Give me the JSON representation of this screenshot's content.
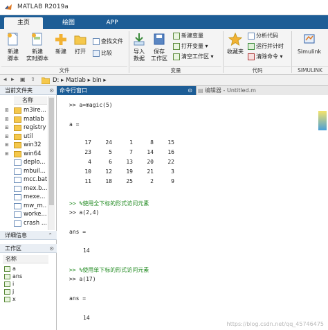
{
  "window": {
    "title": "MATLAB R2019a"
  },
  "tabs": [
    {
      "label": "主页",
      "active": true
    },
    {
      "label": "绘图",
      "active": false
    },
    {
      "label": "APP",
      "active": false
    }
  ],
  "ribbon": {
    "new_script": "新建\n脚本",
    "new_live_script": "新建\n实时脚本",
    "new": "新建",
    "open": "打开",
    "find_files": "查找文件",
    "compare": "比较",
    "import_data": "导入\n数据",
    "save_workspace": "保存\n工作区",
    "new_variable": "新建变量",
    "open_variable": "打开变量",
    "clear_workspace": "清空工作区",
    "favorites": "收藏夹",
    "analyze_code": "分析代码",
    "run_and_time": "运行并计时",
    "clear_commands": "清除命令",
    "simulink": "Simulink",
    "groups": {
      "file": "文件",
      "variable": "变量",
      "code": "代码",
      "simulink": "SIMULINK"
    }
  },
  "address": {
    "path": "D:  ▸  Matlab  ▸  bin  ▸"
  },
  "current_folder": {
    "title": "当前文件夹",
    "column": "名称",
    "items": [
      {
        "name": "m3ire...",
        "type": "folder"
      },
      {
        "name": "matlab",
        "type": "folder"
      },
      {
        "name": "registry",
        "type": "folder"
      },
      {
        "name": "util",
        "type": "folder"
      },
      {
        "name": "win32",
        "type": "folder"
      },
      {
        "name": "win64",
        "type": "folder"
      },
      {
        "name": "deplo...",
        "type": "file"
      },
      {
        "name": "mbuil...",
        "type": "file"
      },
      {
        "name": "mcc.bat",
        "type": "file"
      },
      {
        "name": "mex.b...",
        "type": "file"
      },
      {
        "name": "mexe...",
        "type": "file"
      },
      {
        "name": "mw_m...",
        "type": "file"
      },
      {
        "name": "worke...",
        "type": "file"
      },
      {
        "name": "crash ...",
        "type": "file"
      }
    ]
  },
  "details": {
    "title": "详细信息"
  },
  "workspace": {
    "title": "工作区",
    "column": "名称",
    "variables": [
      "a",
      "ans",
      "i",
      "j",
      "x"
    ]
  },
  "command_window": {
    "title": "命令行窗口",
    "prompt1": ">> a=magic(5)",
    "a_eq": "a =",
    "matrix": [
      [
        17,
        24,
        1,
        8,
        15
      ],
      [
        23,
        5,
        7,
        14,
        16
      ],
      [
        4,
        6,
        13,
        20,
        22
      ],
      [
        10,
        12,
        19,
        21,
        3
      ],
      [
        11,
        18,
        25,
        2,
        9
      ]
    ],
    "comment1": ">> %使用全下标的形式访问元素",
    "prompt2": ">> a(2,4)",
    "ans_eq1": "ans =",
    "ans_val1": "14",
    "comment2": ">> %使用单下标的形式访问元素",
    "prompt3": ">> a(17)",
    "ans_eq2": "ans =",
    "ans_val2": "14"
  },
  "editor_tab": {
    "title": "编辑器 - Untitled.m"
  },
  "watermark": "https://blog.csdn.net/qq_45746475"
}
